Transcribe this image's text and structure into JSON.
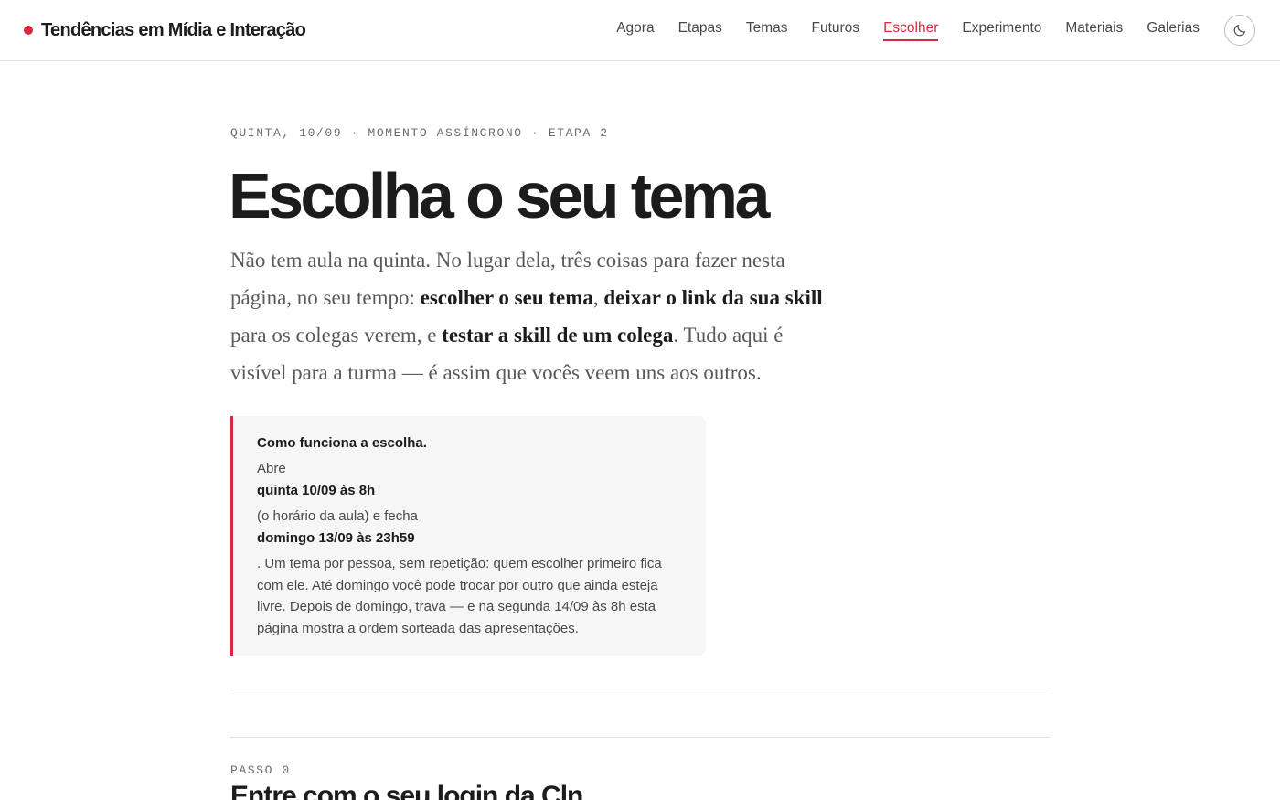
{
  "header": {
    "brand": "Tendências em Mídia e Interação",
    "nav": [
      {
        "label": "Agora",
        "active": false
      },
      {
        "label": "Etapas",
        "active": false
      },
      {
        "label": "Temas",
        "active": false
      },
      {
        "label": "Futuros",
        "active": false
      },
      {
        "label": "Escolher",
        "active": true
      },
      {
        "label": "Experimento",
        "active": false
      },
      {
        "label": "Materiais",
        "active": false
      },
      {
        "label": "Galerias",
        "active": false
      }
    ],
    "theme_toggle_icon": "moon-icon"
  },
  "colors": {
    "accent": "#d6293b",
    "text": "#1c1b1d",
    "muted": "#6e6c70",
    "callout_bg": "#f7f6f7"
  },
  "hero": {
    "kicker": "QUINTA, 10/09 · MOMENTO ASSÍNCRONO · ETAPA 2",
    "title": "Escolha o seu tema",
    "lead": {
      "part1": "Não tem aula na quinta. No lugar dela, três coisas para fazer nesta página, no seu tempo: ",
      "strong1": "escolher o seu tema",
      "sep1": ", ",
      "strong2": "deixar o link da sua skill",
      "part2": " para os colegas verem, e ",
      "strong3": "testar a skill de um colega",
      "part3": ". Tudo aqui é visível para a turma — é assim que vocês veem uns aos outros."
    }
  },
  "callout": {
    "title": "Como funciona a escolha.",
    "opens_label": "Abre",
    "opens_value": "quinta 10/09 às 8h",
    "closes_label": "(o horário da aula) e fecha",
    "closes_value": "domingo 13/09 às 23h59",
    "body": ". Um tema por pessoa, sem repetição: quem escolher primeiro fica com ele. Até domingo você pode trocar por outro que ainda esteja livre. Depois de domingo, trava — e na segunda 14/09 às 8h esta página mostra a ordem sorteada das apresentações."
  },
  "step0": {
    "kicker": "PASSO 0",
    "title": "Entre com o seu login da Cln"
  }
}
